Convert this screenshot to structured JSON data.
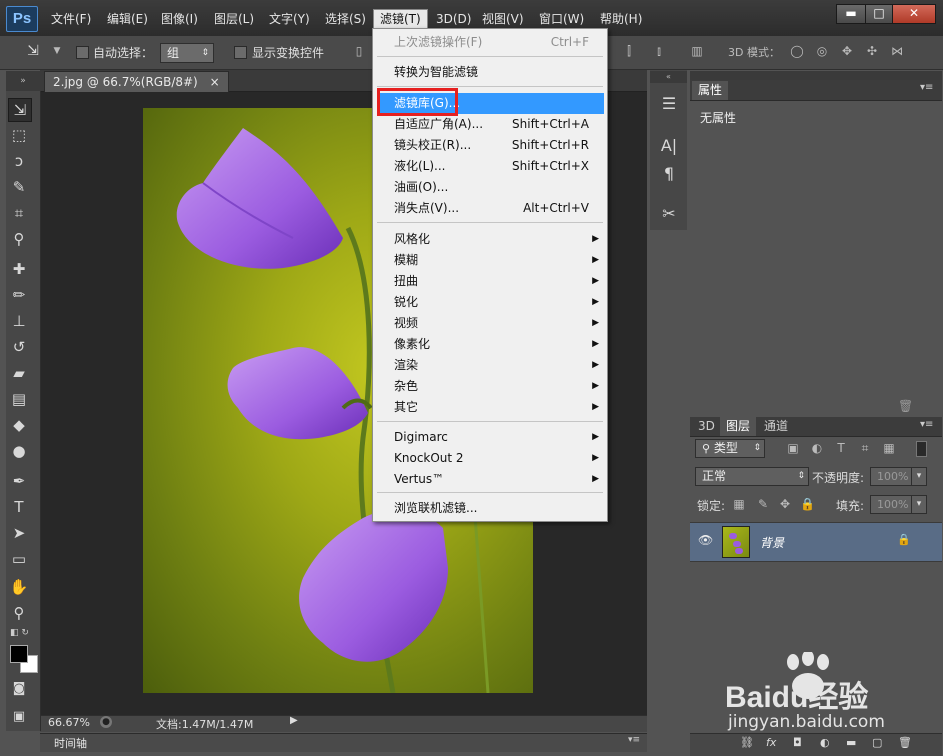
{
  "app": {
    "logo": "Ps"
  },
  "menubar": {
    "items": [
      "文件(F)",
      "编辑(E)",
      "图像(I)",
      "图层(L)",
      "文字(Y)",
      "选择(S)",
      "滤镜(T)",
      "3D(D)",
      "视图(V)",
      "窗口(W)",
      "帮助(H)"
    ],
    "active": "滤镜(T)"
  },
  "window_controls": {
    "minimize": "▬",
    "maximize": "□",
    "close": "✕"
  },
  "optionsbar": {
    "auto_select_label": "自动选择：",
    "auto_select_value": "组",
    "show_transform_label": "显示变换控件",
    "mode_3d_label": "3D 模式："
  },
  "document": {
    "tab_title": "2.jpg @ 66.7%(RGB/8#)",
    "tab_close": "×",
    "zoom": "66.67%",
    "doc_size": "文档:1.47M/1.47M",
    "timeline_label": "时间轴"
  },
  "filter_menu": {
    "items": [
      {
        "label": "上次滤镜操作(F)",
        "shortcut": "Ctrl+F",
        "state": "disabled"
      },
      {
        "label": "转换为智能滤镜",
        "shortcut": "",
        "state": "normal"
      },
      {
        "label": "滤镜库(G)...",
        "shortcut": "",
        "state": "hover"
      },
      {
        "label": "自适应广角(A)...",
        "shortcut": "Shift+Ctrl+A",
        "state": "normal"
      },
      {
        "label": "镜头校正(R)...",
        "shortcut": "Shift+Ctrl+R",
        "state": "normal"
      },
      {
        "label": "液化(L)...",
        "shortcut": "Shift+Ctrl+X",
        "state": "normal"
      },
      {
        "label": "油画(O)...",
        "shortcut": "",
        "state": "normal"
      },
      {
        "label": "消失点(V)...",
        "shortcut": "Alt+Ctrl+V",
        "state": "normal"
      },
      {
        "label": "风格化",
        "submenu": true
      },
      {
        "label": "模糊",
        "submenu": true
      },
      {
        "label": "扭曲",
        "submenu": true
      },
      {
        "label": "锐化",
        "submenu": true
      },
      {
        "label": "视频",
        "submenu": true
      },
      {
        "label": "像素化",
        "submenu": true
      },
      {
        "label": "渲染",
        "submenu": true
      },
      {
        "label": "杂色",
        "submenu": true
      },
      {
        "label": "其它",
        "submenu": true
      },
      {
        "label": "Digimarc",
        "submenu": true
      },
      {
        "label": "KnockOut 2",
        "submenu": true
      },
      {
        "label": "Vertus™",
        "submenu": true
      },
      {
        "label": "浏览联机滤镜..."
      }
    ],
    "submenu_arrow": "▶"
  },
  "properties_panel": {
    "title": "属性",
    "content": "无属性"
  },
  "layers_panel": {
    "tabs": [
      "3D",
      "图层",
      "通道"
    ],
    "active_tab": "图层",
    "kind_label": "类型",
    "blend_mode": "正常",
    "opacity_label": "不透明度:",
    "opacity_value": "100%",
    "lock_label": "锁定:",
    "fill_label": "填充:",
    "fill_value": "100%",
    "layer_name": "背景"
  },
  "watermark": {
    "brand": "Baidu经验",
    "url": "jingyan.baidu.com"
  },
  "colors": {
    "menu_highlight": "#3399ff",
    "annotation_red": "#e62020",
    "layer_selected": "#596c86"
  }
}
